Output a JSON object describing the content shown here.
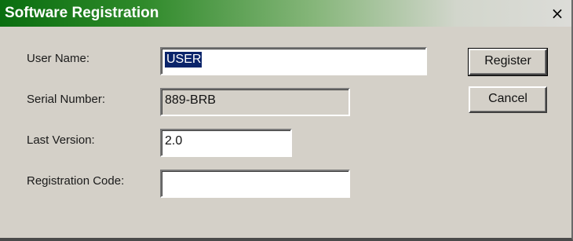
{
  "window": {
    "title": "Software Registration",
    "close_glyph": "×",
    "title_gradient": [
      "#0a6e10",
      "#dcdcd8"
    ]
  },
  "form": {
    "user_name": {
      "label": "User Name:",
      "value": "USER"
    },
    "serial_number": {
      "label": "Serial Number:",
      "value": "889-BRB"
    },
    "last_version": {
      "label": "Last Version:",
      "value": "2.0"
    },
    "registration_code": {
      "label": "Registration Code:",
      "value": ""
    }
  },
  "buttons": {
    "register": "Register",
    "cancel": "Cancel"
  }
}
